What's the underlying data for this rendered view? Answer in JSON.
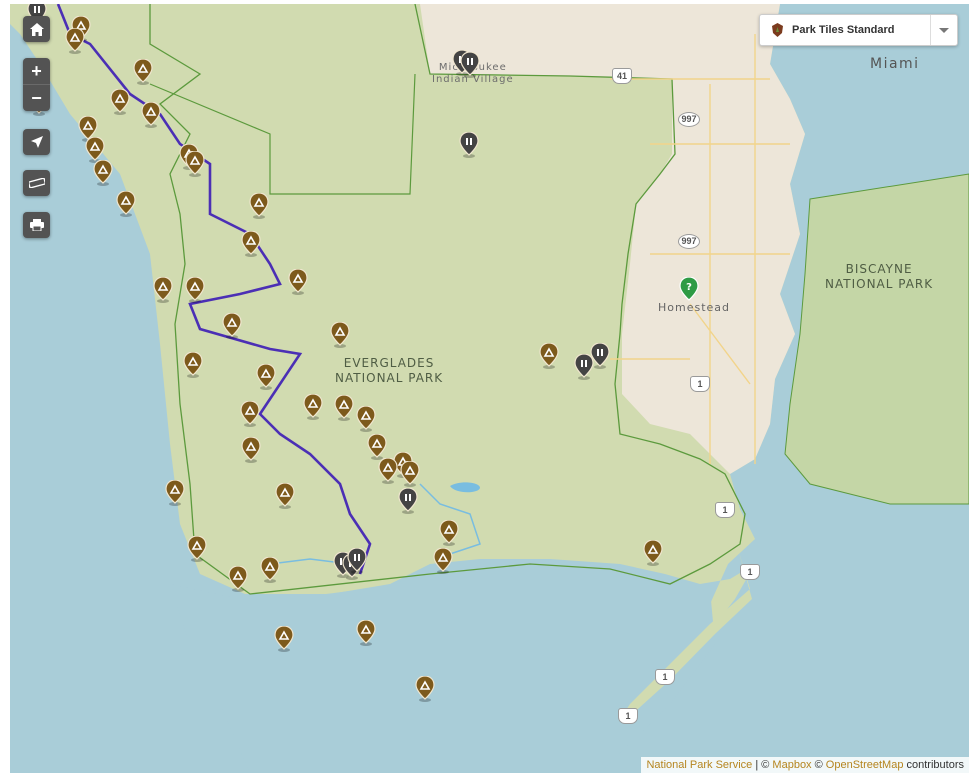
{
  "map": {
    "labels": {
      "everglades_line1": "EVERGLADES",
      "everglades_line2": "NATIONAL PARK",
      "biscayne_line1": "BISCAYNE",
      "biscayne_line2": "NATIONAL PARK",
      "miami": "Miami",
      "homestead": "Homestead",
      "village_line1": "Miccosukee",
      "village_line2": "Indian Village"
    },
    "road_shields": [
      "41",
      "997",
      "997",
      "1",
      "1",
      "1",
      "1",
      "1"
    ],
    "marker_icons": {
      "campsite": "campsite-icon",
      "restroom": "restroom-icon",
      "visitor_center": "visitor-center-icon",
      "information": "information-icon"
    },
    "colors": {
      "water": "#a9cdd8",
      "park_land": "#d1dbb0",
      "urban": "#ede6d9",
      "boundary": "#5c9a3d",
      "paddling_trail": "#4b2fb5",
      "campsite_marker": "#7d5a1c",
      "restroom_marker": "#444444"
    }
  },
  "controls": {
    "home": "home-icon",
    "zoom_in": "+",
    "zoom_out": "−",
    "locate": "locate-arrow-icon",
    "measure": "ruler-icon",
    "print": "print-icon"
  },
  "layer_switcher": {
    "icon": "nps-arrowhead-icon",
    "selected": "Park Tiles Standard"
  },
  "attribution": {
    "nps": "National Park Service",
    "sep1": "| ©",
    "mapbox": "Mapbox",
    "sep2": "©",
    "osm": "OpenStreetMap",
    "suffix": "contributors"
  }
}
